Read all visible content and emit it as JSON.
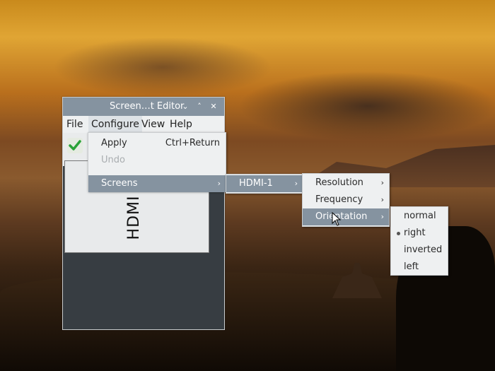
{
  "window": {
    "title": "Screen…t Editor",
    "buttons": {
      "menu": "⌄",
      "maximize": "˄",
      "close": "✕"
    },
    "menubar": {
      "file": "File",
      "configure": "Configure",
      "view": "View",
      "help": "Help"
    },
    "toolbar": {
      "apply_icon": "checkmark-icon"
    },
    "screen": {
      "label": "HDMI"
    }
  },
  "configure_menu": {
    "apply": "Apply",
    "apply_shortcut": "Ctrl+Return",
    "undo": "Undo",
    "screens": "Screens"
  },
  "screens_menu": {
    "items": [
      "HDMI-1"
    ]
  },
  "hdmi_menu": {
    "resolution": "Resolution",
    "frequency": "Frequency",
    "orientation": "Orientation"
  },
  "orientation_menu": {
    "items": [
      "normal",
      "right",
      "inverted",
      "left"
    ],
    "selected": "right"
  },
  "colors": {
    "accent": "#8593a0",
    "check": "#2aa339"
  }
}
